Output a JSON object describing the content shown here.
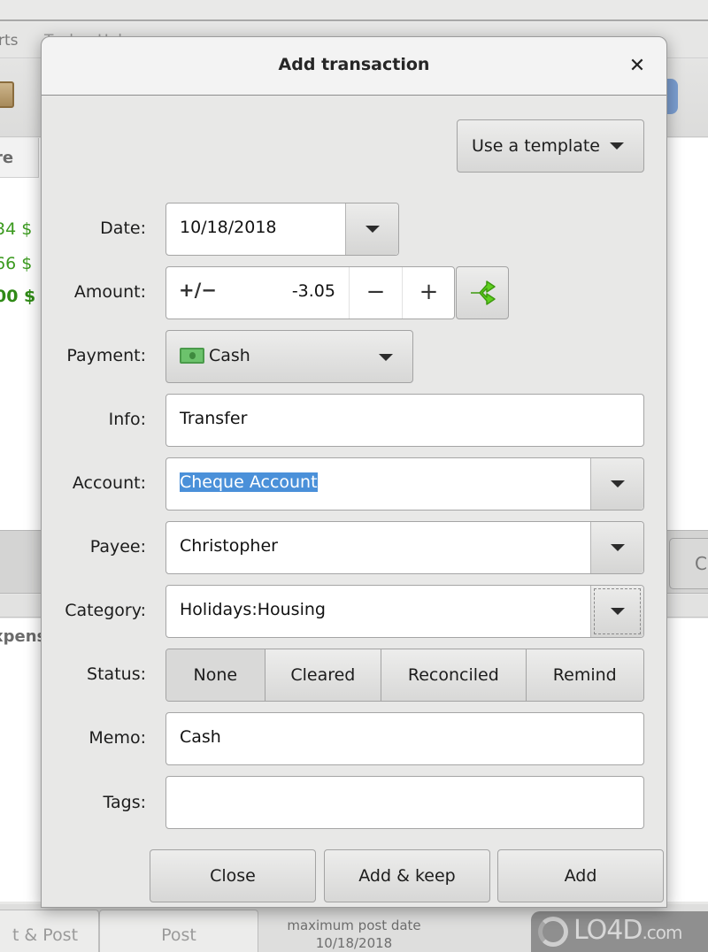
{
  "background_app": {
    "menu_items": [
      "rts",
      "Tools",
      "Help"
    ],
    "list_header": "re",
    "amounts": [
      "34 $",
      "66 $",
      "00 $"
    ],
    "band_button": "C",
    "panel_header": "xpens",
    "bottom_tabs": [
      "t & Post",
      "Post"
    ],
    "post_date_label": "maximum post date",
    "post_date_value": "10/18/2018",
    "watermark": {
      "main": "LO4D",
      "suffix": ".com"
    }
  },
  "dialog": {
    "title": "Add transaction",
    "close_icon": "✕",
    "template_button": "Use a template",
    "fields": {
      "date": {
        "label": "Date:",
        "value": "10/18/2018"
      },
      "amount": {
        "label": "Amount:",
        "sign_toggle": "+/−",
        "value": "-3.05",
        "decrement": "−",
        "increment": "+",
        "split_icon": "split-icon"
      },
      "payment": {
        "label": "Payment:",
        "value": "Cash",
        "icon": "cash-icon"
      },
      "info": {
        "label": "Info:",
        "value": "Transfer"
      },
      "account": {
        "label": "Account:",
        "value": "Cheque Account"
      },
      "payee": {
        "label": "Payee:",
        "value": "Christopher"
      },
      "category": {
        "label": "Category:",
        "value": "Holidays:Housing"
      },
      "status": {
        "label": "Status:",
        "options": [
          "None",
          "Cleared",
          "Reconciled",
          "Remind"
        ],
        "selected": "None"
      },
      "memo": {
        "label": "Memo:",
        "value": "Cash"
      },
      "tags": {
        "label": "Tags:",
        "value": ""
      }
    },
    "buttons": {
      "close": "Close",
      "add_keep": "Add & keep",
      "add": "Add"
    }
  },
  "colors": {
    "selection": "#4a90d9",
    "positive_amount": "#3b9a1f",
    "split_icon": "#5fcf1f"
  }
}
